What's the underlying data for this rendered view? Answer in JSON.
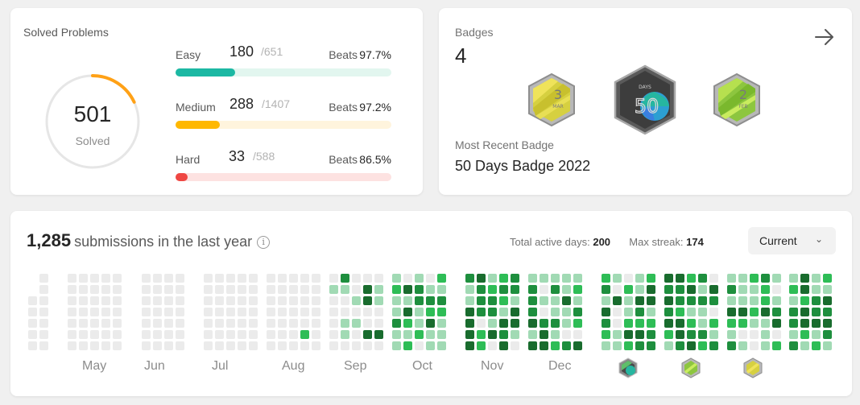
{
  "solved": {
    "title": "Solved Problems",
    "count": "501",
    "count_label": "Solved",
    "ring_fraction": 0.18,
    "ring_color": "#ffa116",
    "difficulties": [
      {
        "label": "Easy",
        "solved": "180",
        "total": "/651",
        "beats_label": "Beats",
        "beats": "97.7%",
        "fraction": 0.276,
        "color": "#1cb8a3",
        "track": "#e2f6ef"
      },
      {
        "label": "Medium",
        "solved": "288",
        "total": "/1407",
        "beats_label": "Beats",
        "beats": "97.2%",
        "fraction": 0.205,
        "color": "#ffb800",
        "track": "#fff4dd"
      },
      {
        "label": "Hard",
        "solved": "33",
        "total": "/588",
        "beats_label": "Beats",
        "beats": "86.5%",
        "fraction": 0.056,
        "color": "#ef4743",
        "track": "#fde2e1"
      }
    ]
  },
  "badges": {
    "label": "Badges",
    "count": "4",
    "items": [
      {
        "name": "Mar badge",
        "number": "3",
        "month": "MAR"
      },
      {
        "name": "50 Days Badge 2022",
        "number": "50",
        "caption": "DAYS"
      },
      {
        "name": "Feb badge",
        "number": "2",
        "month": "FEB"
      }
    ],
    "recent_label": "Most Recent Badge",
    "recent_name": "50 Days Badge 2022"
  },
  "submissions": {
    "count": "1,285",
    "text": "submissions in the last year",
    "active_label": "Total active days:",
    "active_value": "200",
    "streak_label": "Max streak:",
    "streak_value": "174",
    "year_select": "Current",
    "months": [
      "May",
      "Jun",
      "Jul",
      "Aug",
      "Sep",
      "Oct",
      "Nov",
      "Dec"
    ],
    "colors": [
      "#ebebeb",
      "#a1dab4",
      "#2ebd56",
      "#1e8f3e",
      "#196c2e"
    ]
  }
}
